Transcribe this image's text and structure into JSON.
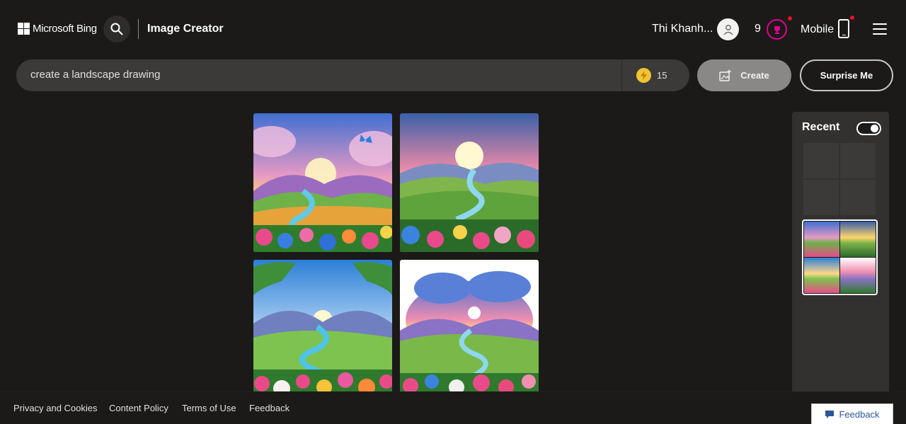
{
  "header": {
    "brand": "Microsoft Bing",
    "app_title": "Image Creator",
    "user_name": "Thi Khanh...",
    "reward_count": "9",
    "mobile_label": "Mobile"
  },
  "prompt": {
    "value": "create a landscape drawing",
    "boosts": "15",
    "create_label": "Create",
    "surprise_label": "Surprise Me"
  },
  "results": [
    {
      "name": "generated-image-1"
    },
    {
      "name": "generated-image-2"
    },
    {
      "name": "generated-image-3"
    },
    {
      "name": "generated-image-4"
    }
  ],
  "recent": {
    "title": "Recent",
    "toggle_on": true
  },
  "footer": {
    "links": [
      "Privacy and Cookies",
      "Content Policy",
      "Terms of Use",
      "Feedback"
    ],
    "feedback_button": "Feedback"
  },
  "colors": {
    "background": "#1b1a19",
    "bar": "#3b3a39",
    "accent_pink": "#e3008c",
    "boost_gold": "#f2c434",
    "feedback_blue": "#2b579a"
  }
}
